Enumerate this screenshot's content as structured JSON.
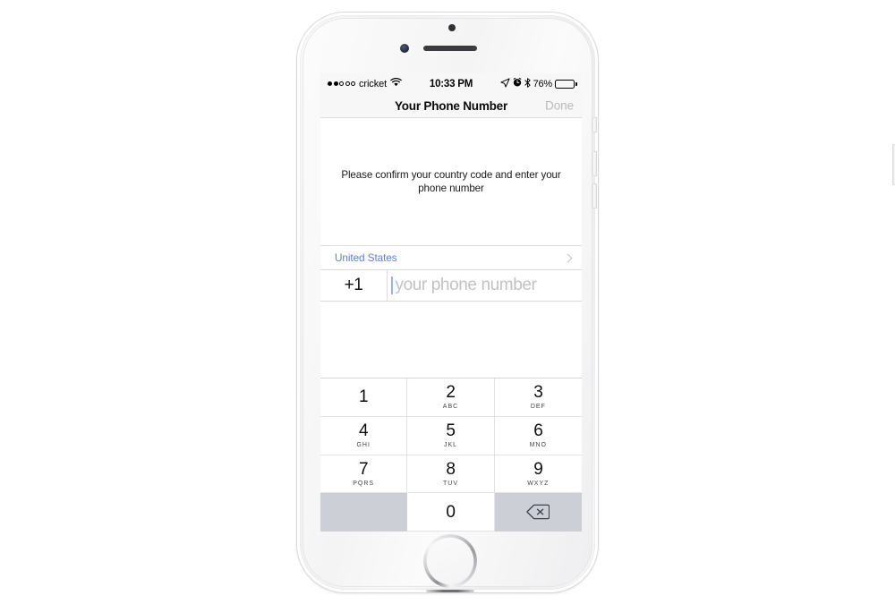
{
  "device": {
    "name": "iPhone",
    "color": "silver"
  },
  "status_bar": {
    "signal_dots_filled": 2,
    "signal_dots_total": 5,
    "carrier": "cricket",
    "wifi_icon": "wifi-icon",
    "time": "10:33 PM",
    "location_icon": "location-arrow-icon",
    "alarm_icon": "alarm-clock-icon",
    "bluetooth_icon": "bluetooth-icon",
    "battery_percent": "76%",
    "battery_level": 76
  },
  "nav_bar": {
    "title": "Your Phone Number",
    "done_label": "Done",
    "done_enabled": false,
    "done_color": "#b9b9bc"
  },
  "instructions": {
    "text": "Please confirm your country code and enter your phone number"
  },
  "country_row": {
    "label": "United States",
    "label_color": "#5a7fe0",
    "chevron_icon": "chevron-right-icon"
  },
  "phone_row": {
    "country_code": "+1",
    "value": "",
    "placeholder": "your phone number",
    "placeholder_color": "#c2c2c6",
    "cursor_color": "#8fb4ef"
  },
  "keypad": {
    "gray_key_color": "#ccd0d6",
    "keys": [
      {
        "digit": "1",
        "letters": "",
        "style": "white"
      },
      {
        "digit": "2",
        "letters": "ABC",
        "style": "white"
      },
      {
        "digit": "3",
        "letters": "DEF",
        "style": "white"
      },
      {
        "digit": "4",
        "letters": "GHI",
        "style": "white"
      },
      {
        "digit": "5",
        "letters": "JKL",
        "style": "white"
      },
      {
        "digit": "6",
        "letters": "MNO",
        "style": "white"
      },
      {
        "digit": "7",
        "letters": "PQRS",
        "style": "white"
      },
      {
        "digit": "8",
        "letters": "TUV",
        "style": "white"
      },
      {
        "digit": "9",
        "letters": "WXYZ",
        "style": "white"
      },
      {
        "digit": "",
        "letters": "",
        "style": "blank"
      },
      {
        "digit": "0",
        "letters": "",
        "style": "white"
      },
      {
        "digit": "",
        "letters": "",
        "style": "backspace",
        "icon": "backspace-icon"
      }
    ]
  }
}
